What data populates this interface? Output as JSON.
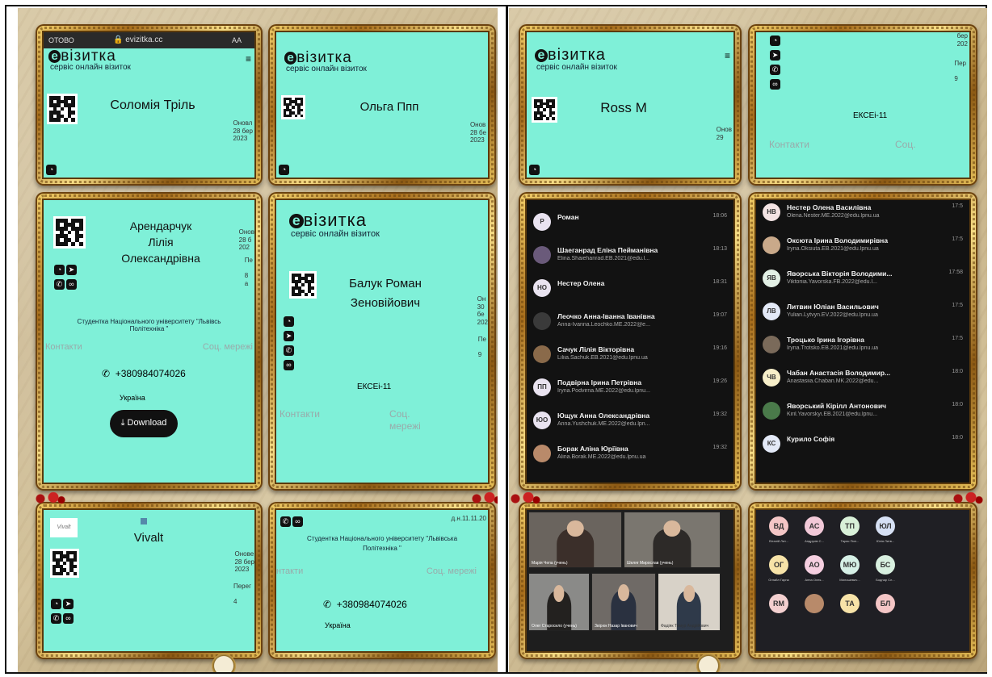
{
  "phone_status": {
    "left": "ОТОВО",
    "url": "evizitka.cc",
    "aa": "AA"
  },
  "brand": {
    "word": "візитка",
    "letter": "e",
    "tagline": "сервіс онлайн візиток",
    "menu": "≡"
  },
  "card1": {
    "name": "Соломія Тріль",
    "updated": "Оновл\n28 бер\n2023"
  },
  "card2": {
    "name": "Ольга Ппп",
    "updated": "Онов\n28 бе\n2023"
  },
  "card3": {
    "name": "Арендарчук\nЛілія\nОлександрівна",
    "side": "Онов\n28 б\n202",
    "side2": "Пе\n\n8\nа",
    "university": "Студентка Національного університету \"Львівсь\nПолітехніка \"",
    "contacts": "Контакти",
    "social": "Соц. мережі",
    "phone": "+380984074026",
    "country": "Україна",
    "download": "Download"
  },
  "card4": {
    "name": "Балук Роман\nЗеновійович",
    "side": "Он\n30\nбе\n202",
    "side2": "Пе\n\n9",
    "group": "ЕКСЕі-11",
    "contacts": "Контакти",
    "social": "Соц.\nмережі"
  },
  "card5": {
    "name": "Vivalt",
    "logo_text": "Vivalt",
    "updated": "Онове\n28 бер\n2023",
    "side2": "Перег\n\n4"
  },
  "card6": {
    "date": "д.н.11.11.20",
    "university": "Студентка Національного університету \"Львівська\nПолітехніка \"",
    "contacts": "нтакти",
    "social": "Соц. мережі",
    "phone": "+380984074026",
    "country": "Україна"
  },
  "card7": {
    "name": "Ross M",
    "updated": "Онов\n29"
  },
  "card8": {
    "date_side": "бер\n202",
    "side2": "Пер\n\n9",
    "group": "ЕКСЕі-11",
    "contacts": "Контакти",
    "social": "Соц."
  },
  "chat_left": [
    {
      "initials": "Р",
      "name": "Роман",
      "email": "",
      "time": "18:06",
      "color": "#e9e3f0"
    },
    {
      "initials": "",
      "name": "Шаеганрад Еліна Пейманівна",
      "email": "Elina.Shaiehanrad.EB.2021@edu.l...",
      "time": "18:13",
      "color": "#6a5a7a"
    },
    {
      "initials": "НО",
      "name": "Нестер Олена",
      "email": "",
      "time": "18:31",
      "color": "#e9e3f0"
    },
    {
      "initials": "",
      "name": "Леочко Анна-Іванна Іванівна",
      "email": "Anna-Ivanna.Leochko.ME.2022@e...",
      "time": "19:07",
      "color": "#3a3a3a"
    },
    {
      "initials": "",
      "name": "Сачук Лілія Вікторівна",
      "email": "Liliia.Sachuk.EB.2021@edu.lpnu.ua",
      "time": "19:16",
      "color": "#8a6a4a"
    },
    {
      "initials": "ПП",
      "name": "Подвірна Ірина Петрівна",
      "email": "Iryna.Podvirna.ME.2022@edu.lpnu...",
      "time": "19:26",
      "color": "#e9e3f0"
    },
    {
      "initials": "ЮО",
      "name": "Ющук Анна Олександрівна",
      "email": "Anna.Yushchuk.ME.2022@edu.lpn...",
      "time": "19:32",
      "color": "#e9e3f0"
    },
    {
      "initials": "",
      "name": "Борак Аліна Юріївна",
      "email": "Alina.Borak.ME.2022@edu.lpnu.ua",
      "time": "19:32",
      "color": "#b98a6a"
    }
  ],
  "chat_right": [
    {
      "initials": "НВ",
      "name": "Нестер Олена Василівна",
      "email": "Olena.Nester.ME.2022@edu.lpnu.ua",
      "time": "17:5",
      "color": "#f3e3e3"
    },
    {
      "initials": "",
      "name": "Оксюта Ірина Володимирівна",
      "email": "Iryna.Oksiuta.EB.2021@edu.lpnu.ua",
      "time": "17:5",
      "color": "#c9a98a"
    },
    {
      "initials": "ЯВ",
      "name": "Яворська Вікторія Володими...",
      "email": "Viktoriia.Yavorska.FB.2022@edu.l...",
      "time": "17:58",
      "color": "#e3f0e6"
    },
    {
      "initials": "ЛВ",
      "name": "Литвин Юліан Васильович",
      "email": "Yulian.Lytvyn.EV.2022@edu.lpnu.ua",
      "time": "17:5",
      "color": "#e3e9f7"
    },
    {
      "initials": "",
      "name": "Троцько Ірина Ігорівна",
      "email": "Iryna.Trotsko.EB.2021@edu.lpnu.ua",
      "time": "17:5",
      "color": "#7a6a5a"
    },
    {
      "initials": "ЧВ",
      "name": "Чабан Анастасія Володимир...",
      "email": "Anastasiia.Chaban.MK.2022@edu...",
      "time": "18:0",
      "color": "#f7efc9"
    },
    {
      "initials": "",
      "name": "Яворський Кірілл Антонович",
      "email": "Kiril.Yavorskyi.EB.2021@edu.lpnu...",
      "time": "18:0",
      "color": "#4a7a4a"
    },
    {
      "initials": "КС",
      "name": "Курило Софія",
      "email": "",
      "time": "18:0",
      "color": "#e3e9f7"
    }
  ],
  "bubbles": [
    {
      "t": "ВД",
      "c": "#f4c6c6"
    },
    {
      "t": "АС",
      "c": "#f2c9d8"
    },
    {
      "t": "ТП",
      "c": "#d8f0d8"
    },
    {
      "t": "ЮЛ",
      "c": "#d6e0f4"
    },
    {
      "t": "ОГ",
      "c": "#f7e3a8"
    },
    {
      "t": "АО",
      "c": "#f6cfe0"
    },
    {
      "t": "МЮ",
      "c": "#d6f0e6"
    },
    {
      "t": "БС",
      "c": "#d8f0e0"
    },
    {
      "t": "RM",
      "c": "#f4d0d0"
    },
    {
      "t": "",
      "c": "#b88a6a"
    },
    {
      "t": "ТА",
      "c": "#f7e3a8"
    },
    {
      "t": "БЛ",
      "c": "#f4c6c6"
    }
  ],
  "bubble_names": [
    "Віталій Лит...",
    "Андрусів С...",
    "Тарас Пил...",
    "Юлія Литв...",
    "Оглайл Гарна",
    "Анна Олек...",
    "Милошевич...",
    "Боднар Сл...",
    "",
    "",
    "",
    ""
  ],
  "video_labels": [
    "Марія Чепа (учень)",
    "Шеляг Мирослав (учень)",
    "Олег Старосило (учень)",
    "Звірюк Назар Іванович",
    "Фадіяк Тимур Андрійович"
  ]
}
